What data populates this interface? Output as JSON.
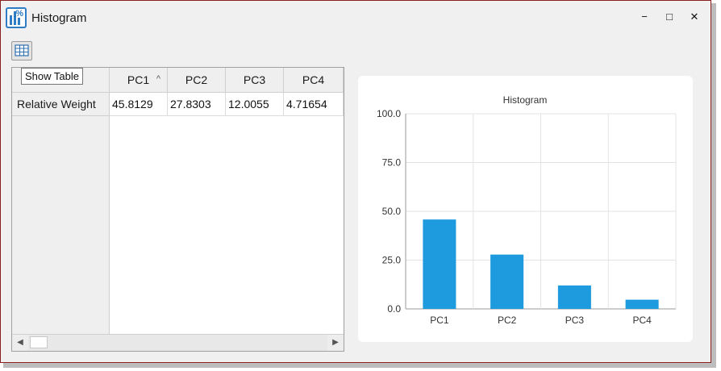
{
  "window": {
    "title": "Histogram",
    "controls": {
      "minimize": "−",
      "maximize": "□",
      "close": "✕"
    }
  },
  "toolbar": {
    "show_table_tooltip": "Show Table"
  },
  "table": {
    "columns": [
      "PC1",
      "PC2",
      "PC3",
      "PC4"
    ],
    "sorted_column": "PC1",
    "rows": [
      {
        "label": "Relative Weight",
        "values": [
          "45.8129",
          "27.8303",
          "12.0055",
          "4.71654"
        ]
      }
    ]
  },
  "chart_data": {
    "type": "bar",
    "title": "Histogram",
    "categories": [
      "PC1",
      "PC2",
      "PC3",
      "PC4"
    ],
    "values": [
      45.8129,
      27.8303,
      12.0055,
      4.71654
    ],
    "ylim": [
      0,
      100
    ],
    "yticks": [
      "0.0",
      "25.0",
      "50.0",
      "75.0",
      "100.0"
    ],
    "grid": true,
    "bar_color": "#1e9bde"
  }
}
